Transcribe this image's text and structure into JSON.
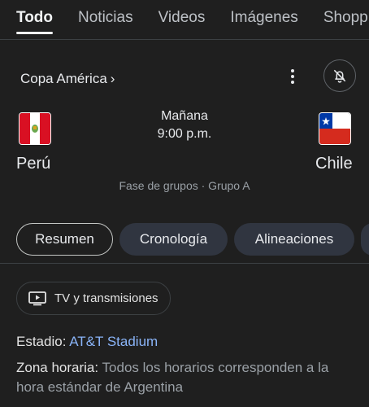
{
  "tabs": [
    "Todo",
    "Noticias",
    "Videos",
    "Imágenes",
    "Shoppin"
  ],
  "match": {
    "competition": "Copa América",
    "chevron": "›",
    "home_team": "Perú",
    "away_team": "Chile",
    "day": "Mañana",
    "time": "9:00 p.m.",
    "stage": "Fase de grupos · Grupo A"
  },
  "chips": [
    "Resumen",
    "Cronología",
    "Alineaciones"
  ],
  "tv": {
    "label": "TV y transmisiones",
    "icon": "tv-icon"
  },
  "info": {
    "estadio_label": "Estadio:",
    "estadio_value": "AT&T Stadium",
    "zona_label": "Zona horaria:",
    "zona_value": "Todos los horarios corresponden a la hora estándar de Argentina"
  },
  "colors": {
    "background": "#1f1f1f",
    "link": "#8ab4f8",
    "chip": "#303540",
    "peru_red": "#d91023",
    "chile_red": "#d52b1e",
    "chile_blue": "#0039a6"
  }
}
